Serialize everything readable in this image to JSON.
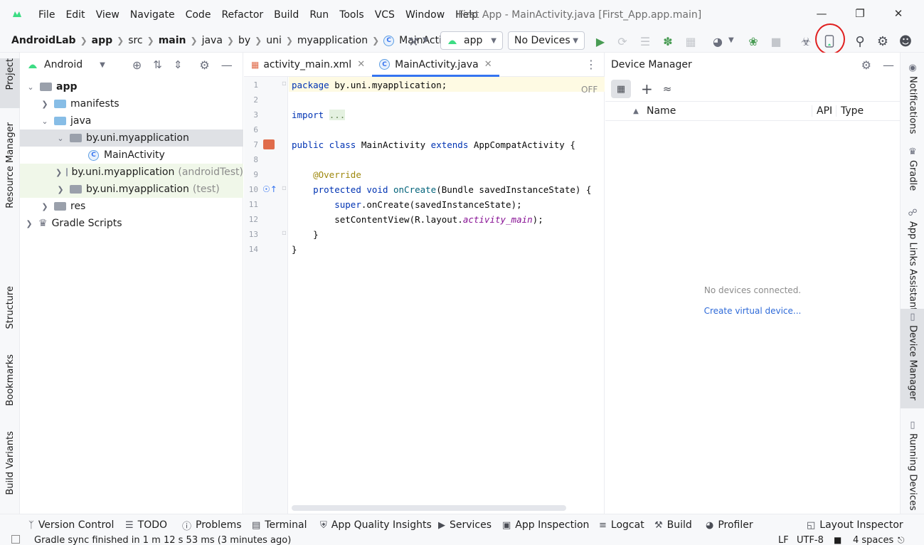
{
  "menubar": {
    "items": [
      "File",
      "Edit",
      "View",
      "Navigate",
      "Code",
      "Refactor",
      "Build",
      "Run",
      "Tools",
      "VCS",
      "Window",
      "Help"
    ],
    "window_title": "First App - MainActivity.java [First_App.app.main]"
  },
  "navbar": {
    "breadcrumbs": [
      "AndroidLab",
      "app",
      "src",
      "main",
      "java",
      "by",
      "uni",
      "myapplication",
      "MainActivity"
    ],
    "run_config": "app",
    "device_selector": "No Devices"
  },
  "left_stripe": {
    "tabs": [
      "Project",
      "Resource Manager",
      "Structure",
      "Bookmarks",
      "Build Variants"
    ]
  },
  "project": {
    "view_mode": "Android",
    "tree": [
      {
        "label": "app",
        "suffix": ""
      },
      {
        "label": "manifests",
        "suffix": ""
      },
      {
        "label": "java",
        "suffix": ""
      },
      {
        "label": "by.uni.myapplication",
        "suffix": ""
      },
      {
        "label": "MainActivity",
        "suffix": ""
      },
      {
        "label": "by.uni.myapplication",
        "suffix": "(androidTest)"
      },
      {
        "label": "by.uni.myapplication",
        "suffix": "(test)"
      },
      {
        "label": "res",
        "suffix": ""
      },
      {
        "label": "Gradle Scripts",
        "suffix": ""
      }
    ]
  },
  "editor": {
    "tabs": [
      {
        "label": "activity_main.xml"
      },
      {
        "label": "MainActivity.java"
      }
    ],
    "inspection_status": "OFF",
    "line_numbers": [
      "1",
      "2",
      "3",
      "6",
      "7",
      "8",
      "9",
      "10",
      "11",
      "12",
      "13",
      "14"
    ]
  },
  "device_manager": {
    "title": "Device Manager",
    "columns": [
      "Name",
      "API",
      "Type"
    ],
    "empty_message": "No devices connected.",
    "create_link": "Create virtual device..."
  },
  "right_stripe": {
    "tabs": [
      "Notifications",
      "Gradle",
      "App Links Assistant",
      "Device Manager",
      "Running Devices"
    ]
  },
  "bottom_tools": [
    "Version Control",
    "TODO",
    "Problems",
    "Terminal",
    "App Quality Insights",
    "Services",
    "App Inspection",
    "Logcat",
    "Build",
    "Profiler",
    "Layout Inspector"
  ],
  "statusbar": {
    "message": "Gradle sync finished in 1 m 12 s 53 ms (3 minutes ago)",
    "line_separator": "LF",
    "encoding": "UTF-8",
    "indent": "4 spaces"
  },
  "colors": {
    "accent": "#3574f0",
    "highlight_circle": "#e02020",
    "run_green": "#499c54"
  }
}
